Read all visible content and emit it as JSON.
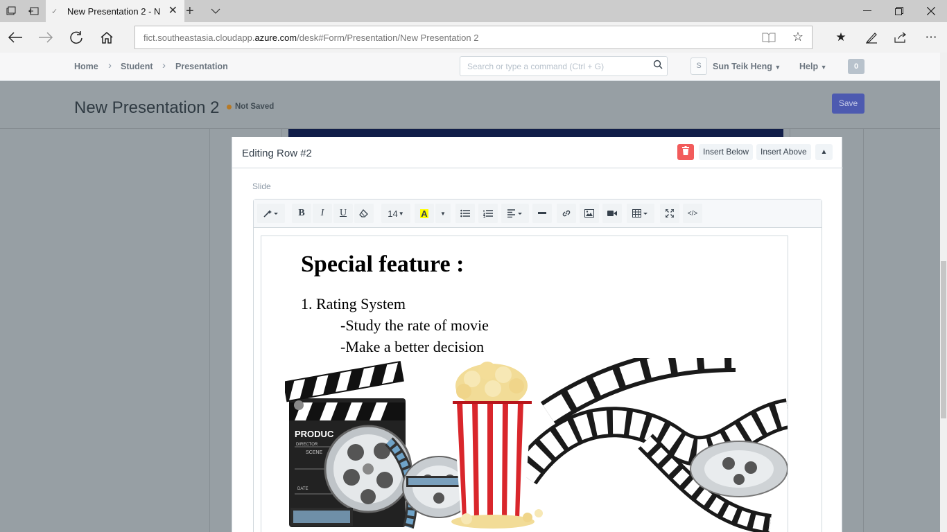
{
  "browser": {
    "tab_title": "New Presentation 2 - N",
    "url_prefix": "fict.southeastasia.cloudapp.",
    "url_domain": "azure.com",
    "url_path": "/desk#Form/Presentation/New Presentation 2"
  },
  "navbar": {
    "breadcrumbs": [
      "Home",
      "Student",
      "Presentation"
    ],
    "search_placeholder": "Search or type a command (Ctrl + G)",
    "avatar_letter": "S",
    "user_name": "Sun Teik Heng",
    "help_label": "Help",
    "notification_count": "0"
  },
  "page": {
    "title": "New Presentation 2",
    "status": "Not Saved",
    "save_label": "Save"
  },
  "row_editor": {
    "title": "Editing Row #2",
    "insert_below": "Insert Below",
    "insert_above": "Insert Above",
    "field_label": "Slide"
  },
  "toolbar": {
    "bold": "B",
    "italic": "I",
    "underline": "U",
    "font_size": "14",
    "highlight": "A",
    "code_view": "</>"
  },
  "slide": {
    "heading": "Special feature :",
    "line1": "1. Rating System",
    "line2": "-Study the rate of movie",
    "line3": "-Make a better decision",
    "clapper_text": "PRODUC",
    "clapper_sub1": "DIRECTOR",
    "clapper_sub2": "SCENE",
    "clapper_sub3": "DATE"
  },
  "colors": {
    "save_button": "#5e64ff",
    "delete_button": "#ff5858",
    "indicator_dot": "#ffa00a"
  }
}
